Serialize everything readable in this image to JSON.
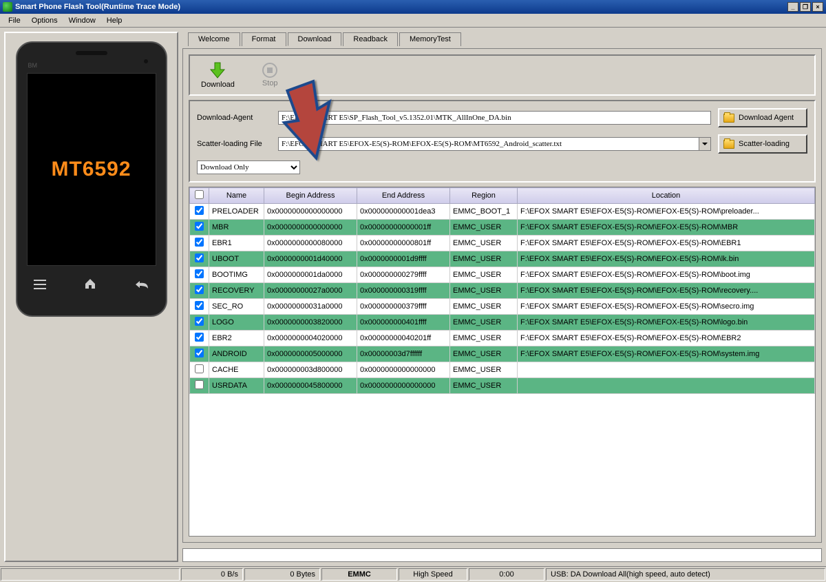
{
  "window": {
    "title": "Smart Phone Flash Tool(Runtime Trace Mode)"
  },
  "menu": {
    "file": "File",
    "options": "Options",
    "window": "Window",
    "help": "Help"
  },
  "phone": {
    "brand_mark": "BM",
    "screen_text": "MT6592"
  },
  "tabs": {
    "welcome": "Welcome",
    "format": "Format",
    "download": "Download",
    "readback": "Readback",
    "memorytest": "MemoryTest"
  },
  "toolbar": {
    "download": "Download",
    "stop": "Stop"
  },
  "files": {
    "da_label": "Download-Agent",
    "da_path": "F:\\EFOX SMART E5\\SP_Flash_Tool_v5.1352.01\\MTK_AllInOne_DA.bin",
    "da_btn": "Download Agent",
    "scatter_label": "Scatter-loading File",
    "scatter_path": "F:\\EFOX SMART E5\\EFOX-E5(S)-ROM\\EFOX-E5(S)-ROM\\MT6592_Android_scatter.txt",
    "scatter_btn": "Scatter-loading",
    "mode": "Download Only"
  },
  "table": {
    "headers": {
      "name": "Name",
      "begin": "Begin Address",
      "end": "End Address",
      "region": "Region",
      "location": "Location"
    },
    "rows": [
      {
        "chk": true,
        "name": "PRELOADER",
        "begin": "0x0000000000000000",
        "end": "0x000000000001dea3",
        "region": "EMMC_BOOT_1",
        "loc": "F:\\EFOX SMART E5\\EFOX-E5(S)-ROM\\EFOX-E5(S)-ROM\\preloader..."
      },
      {
        "chk": true,
        "name": "MBR",
        "begin": "0x0000000000000000",
        "end": "0x00000000000001ff",
        "region": "EMMC_USER",
        "loc": "F:\\EFOX SMART E5\\EFOX-E5(S)-ROM\\EFOX-E5(S)-ROM\\MBR"
      },
      {
        "chk": true,
        "name": "EBR1",
        "begin": "0x0000000000080000",
        "end": "0x00000000000801ff",
        "region": "EMMC_USER",
        "loc": "F:\\EFOX SMART E5\\EFOX-E5(S)-ROM\\EFOX-E5(S)-ROM\\EBR1"
      },
      {
        "chk": true,
        "name": "UBOOT",
        "begin": "0x0000000001d40000",
        "end": "0x0000000001d9ffff",
        "region": "EMMC_USER",
        "loc": "F:\\EFOX SMART E5\\EFOX-E5(S)-ROM\\EFOX-E5(S)-ROM\\lk.bin"
      },
      {
        "chk": true,
        "name": "BOOTIMG",
        "begin": "0x0000000001da0000",
        "end": "0x000000000279ffff",
        "region": "EMMC_USER",
        "loc": "F:\\EFOX SMART E5\\EFOX-E5(S)-ROM\\EFOX-E5(S)-ROM\\boot.img"
      },
      {
        "chk": true,
        "name": "RECOVERY",
        "begin": "0x00000000027a0000",
        "end": "0x000000000319ffff",
        "region": "EMMC_USER",
        "loc": "F:\\EFOX SMART E5\\EFOX-E5(S)-ROM\\EFOX-E5(S)-ROM\\recovery...."
      },
      {
        "chk": true,
        "name": "SEC_RO",
        "begin": "0x00000000031a0000",
        "end": "0x000000000379ffff",
        "region": "EMMC_USER",
        "loc": "F:\\EFOX SMART E5\\EFOX-E5(S)-ROM\\EFOX-E5(S)-ROM\\secro.img"
      },
      {
        "chk": true,
        "name": "LOGO",
        "begin": "0x0000000003820000",
        "end": "0x000000000401ffff",
        "region": "EMMC_USER",
        "loc": "F:\\EFOX SMART E5\\EFOX-E5(S)-ROM\\EFOX-E5(S)-ROM\\logo.bin"
      },
      {
        "chk": true,
        "name": "EBR2",
        "begin": "0x0000000004020000",
        "end": "0x00000000040201ff",
        "region": "EMMC_USER",
        "loc": "F:\\EFOX SMART E5\\EFOX-E5(S)-ROM\\EFOX-E5(S)-ROM\\EBR2"
      },
      {
        "chk": true,
        "name": "ANDROID",
        "begin": "0x0000000005000000",
        "end": "0x00000003d7ffffff",
        "region": "EMMC_USER",
        "loc": "F:\\EFOX SMART E5\\EFOX-E5(S)-ROM\\EFOX-E5(S)-ROM\\system.img"
      },
      {
        "chk": false,
        "name": "CACHE",
        "begin": "0x000000003d800000",
        "end": "0x0000000000000000",
        "region": "EMMC_USER",
        "loc": ""
      },
      {
        "chk": false,
        "name": "USRDATA",
        "begin": "0x0000000045800000",
        "end": "0x0000000000000000",
        "region": "EMMC_USER",
        "loc": ""
      }
    ]
  },
  "status": {
    "speed": "0 B/s",
    "bytes": "0 Bytes",
    "storage": "EMMC",
    "mode": "High Speed",
    "time": "0:00",
    "usb": "USB: DA Download All(high speed, auto detect)"
  }
}
